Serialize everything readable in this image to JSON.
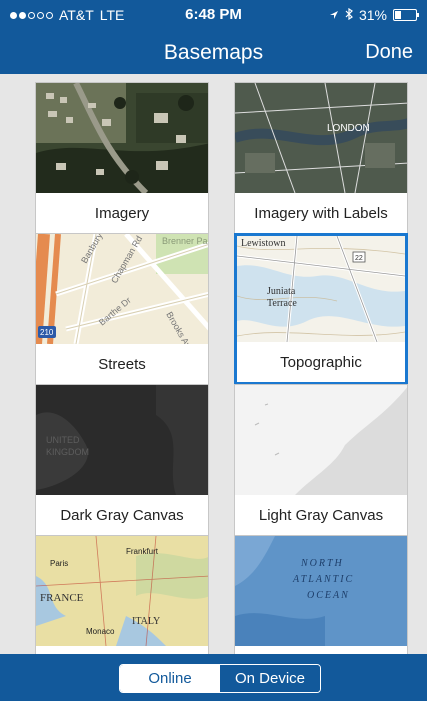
{
  "status": {
    "carrier": "AT&T",
    "network": "LTE",
    "time": "6:48 PM",
    "battery": "31%",
    "battery_level": 0.31
  },
  "nav": {
    "title": "Basemaps",
    "done_label": "Done"
  },
  "basemaps": [
    {
      "label": "Imagery",
      "selected": false
    },
    {
      "label": "Imagery with Labels",
      "selected": false
    },
    {
      "label": "Streets",
      "selected": false
    },
    {
      "label": "Topographic",
      "selected": true
    },
    {
      "label": "Dark Gray Canvas",
      "selected": false
    },
    {
      "label": "Light Gray Canvas",
      "selected": false
    }
  ],
  "map_text": {
    "imagery_labels_city": "LONDON",
    "streets_a": "Banbury Rd",
    "streets_b": "Chapman Rd",
    "streets_c": "Brenner Park",
    "streets_d": "Barthe Dr",
    "streets_e": "Brooks Ave",
    "streets_shield": "210",
    "topo_a": "Lewistown",
    "topo_b": "Juniata",
    "topo_c": "Terrace",
    "topo_shield": "22",
    "dark_a": "UNITED",
    "dark_b": "KINGDOM",
    "natgeo_a": "Frankfurt",
    "natgeo_b": "Paris",
    "natgeo_c": "FRANCE",
    "natgeo_d": "Monaco",
    "natgeo_e": "ITALY",
    "ocean_a": "NORTH",
    "ocean_b": "ATLANTIC",
    "ocean_c": "OCEAN"
  },
  "segment": {
    "online": "Online",
    "on_device": "On Device",
    "active": "online"
  }
}
